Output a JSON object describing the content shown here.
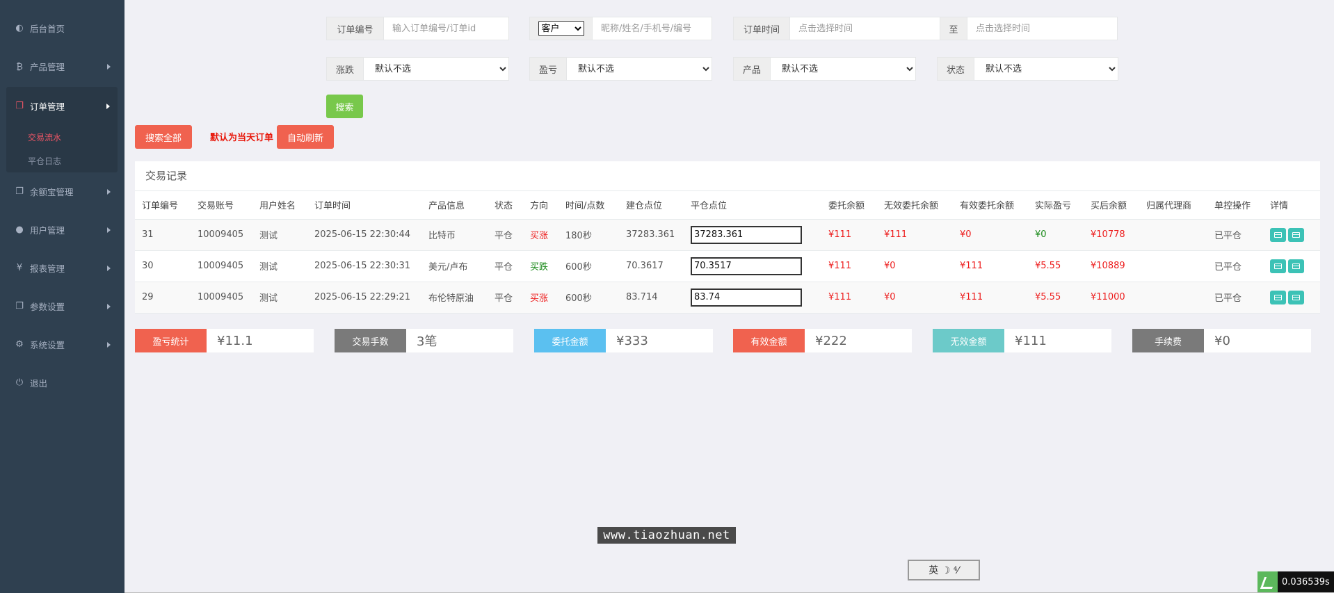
{
  "sidebar": {
    "items": [
      {
        "label": "后台首页",
        "icon": "dashboard-icon"
      },
      {
        "label": "产品管理",
        "icon": "bitcoin-icon"
      },
      {
        "label": "订单管理",
        "icon": "copy-icon"
      },
      {
        "label": "余额宝管理",
        "icon": "copy-icon"
      },
      {
        "label": "用户管理",
        "icon": "user-icon"
      },
      {
        "label": "报表管理",
        "icon": "yen-icon"
      },
      {
        "label": "参数设置",
        "icon": "copy-icon"
      },
      {
        "label": "系统设置",
        "icon": "gears-icon"
      },
      {
        "label": "退出",
        "icon": "power-icon"
      }
    ],
    "sub_items": [
      "交易流水",
      "平仓日志"
    ]
  },
  "filters": {
    "order_no_label": "订单编号",
    "order_no_placeholder": "输入订单编号/订单id",
    "customer_select": "客户",
    "customer_placeholder": "昵称/姓名/手机号/编号",
    "order_time_label": "订单时间",
    "time_placeholder": "点击选择时间",
    "to_label": "至",
    "rise_fall_label": "涨跌",
    "profit_label": "盈亏",
    "product_label": "产品",
    "status_label": "状态",
    "default_option": "默认不选",
    "search_button": "搜索",
    "search_all_button": "搜索全部",
    "default_note": "默认为当天订单",
    "auto_refresh_button": "自动刷新"
  },
  "table": {
    "title": "交易记录",
    "columns": [
      "订单编号",
      "交易账号",
      "用户姓名",
      "订单时间",
      "产品信息",
      "状态",
      "方向",
      "时间/点数",
      "建仓点位",
      "平仓点位",
      "委托余额",
      "无效委托余额",
      "有效委托余额",
      "实际盈亏",
      "买后余额",
      "归属代理商",
      "单控操作",
      "详情"
    ],
    "rows": [
      {
        "id": "31",
        "account": "10009405",
        "name": "测试",
        "time": "2025-06-15 22:30:44",
        "product": "比特币",
        "status": "平仓",
        "direction": "买涨",
        "duration": "180秒",
        "open": "37283.361",
        "close": "37283.361",
        "entrust": "¥111",
        "invalid": "¥111",
        "valid": "¥0",
        "pnl": "¥0",
        "after": "¥10778",
        "agent": "",
        "op": "已平仓"
      },
      {
        "id": "30",
        "account": "10009405",
        "name": "测试",
        "time": "2025-06-15 22:30:31",
        "product": "美元/卢布",
        "status": "平仓",
        "direction": "买跌",
        "duration": "600秒",
        "open": "70.3617",
        "close": "70.3517",
        "entrust": "¥111",
        "invalid": "¥0",
        "valid": "¥111",
        "pnl": "¥5.55",
        "after": "¥10889",
        "agent": "",
        "op": "已平仓"
      },
      {
        "id": "29",
        "account": "10009405",
        "name": "测试",
        "time": "2025-06-15 22:29:21",
        "product": "布伦特原油",
        "status": "平仓",
        "direction": "买涨",
        "duration": "600秒",
        "open": "83.714",
        "close": "83.74",
        "entrust": "¥111",
        "invalid": "¥0",
        "valid": "¥111",
        "pnl": "¥5.55",
        "after": "¥11000",
        "agent": "",
        "op": "已平仓"
      }
    ]
  },
  "stats": [
    {
      "label": "盈亏统计",
      "value": "¥11.1",
      "color": "#f0624f"
    },
    {
      "label": "交易手数",
      "value": "3笔",
      "color": "#7a7a7a"
    },
    {
      "label": "委托金额",
      "value": "¥333",
      "color": "#5bc0f0"
    },
    {
      "label": "有效金额",
      "value": "¥222",
      "color": "#f0624f"
    },
    {
      "label": "无效金额",
      "value": "¥111",
      "color": "#6ccac9"
    },
    {
      "label": "手续费",
      "value": "¥0",
      "color": "#7a7a7a"
    }
  ],
  "colors": {
    "sidebar_bg": "#2f4050",
    "accent_red": "#ed5565",
    "green_button": "#78c84b",
    "teal": "#3cc2b6"
  },
  "watermark": "www.tiaozhuan.net",
  "ime_text": "英 ☽ ⁴⁄",
  "timer": "0.036539s"
}
